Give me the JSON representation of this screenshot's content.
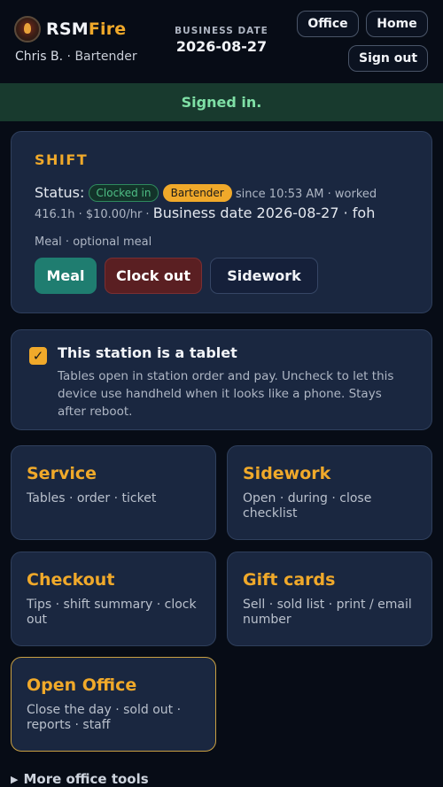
{
  "header": {
    "brand_part1": "RSM",
    "brand_part2": "Fire",
    "user_name": "Chris B.",
    "separator": " · ",
    "user_role": "Bartender",
    "business_date_label": "BUSINESS DATE",
    "business_date": "2026-08-27",
    "office_label": "Office",
    "home_label": "Home",
    "signout_label": "Sign out"
  },
  "banner": {
    "text": "Signed in."
  },
  "shift": {
    "title": "SHIFT",
    "status_label": "Status:",
    "status_pill": "Clocked in",
    "role_pill": "Bartender",
    "since_text": "since 10:53 AM · worked",
    "worked_rate": "416.1h · $10.00/hr ·",
    "business_date_text": "Business date 2026-08-27 · foh",
    "meal_note": "Meal · optional meal",
    "meal_button": "Meal",
    "clockout_button": "Clock out",
    "sidework_button": "Sidework"
  },
  "tablet": {
    "checked": true,
    "title": "This station is a tablet",
    "description": "Tables open in station order and pay. Uncheck to let this device use handheld when it looks like a phone. Stays after reboot."
  },
  "tiles": {
    "service": {
      "title": "Service",
      "desc": "Tables · order · ticket"
    },
    "sidework": {
      "title": "Sidework",
      "desc": "Open · during · close checklist"
    },
    "checkout": {
      "title": "Checkout",
      "desc": "Tips · shift summary · clock out"
    },
    "gift_cards": {
      "title": "Gift cards",
      "desc": "Sell · sold list · print / email number"
    },
    "open_office": {
      "title": "Open Office",
      "desc": "Close the day · sold out · reports · staff"
    }
  },
  "more_tools": {
    "label": "More office tools"
  },
  "colors": {
    "background": "#070c16",
    "accent": "#f0a92a",
    "card": "#1a2740",
    "banner": "#183a2e",
    "meal": "#1f7d70",
    "clockout": "#5a1f22"
  },
  "icons": {
    "logo": "fire-badge-icon",
    "check": "checkmark-icon",
    "disclosure": "triangle-right-icon"
  }
}
